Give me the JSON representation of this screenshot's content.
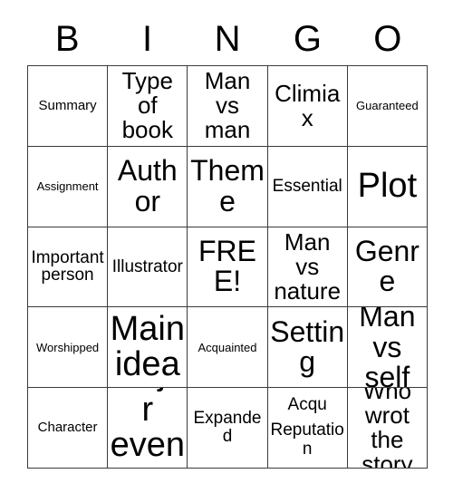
{
  "card": {
    "type": "bingo-card",
    "columns": 5,
    "rows": 5,
    "header_letters": [
      "B",
      "I",
      "N",
      "G",
      "O"
    ],
    "grid": [
      [
        {
          "text": "Summary",
          "size": "sm"
        },
        {
          "text": "Type of book",
          "size": "xl"
        },
        {
          "text": "Man vs man",
          "size": "xl"
        },
        {
          "text": "Climiax",
          "size": "xl"
        },
        {
          "text": "Guaranteed",
          "size": "xs"
        }
      ],
      [
        {
          "text": "Assignment",
          "size": "xs"
        },
        {
          "text": "Author",
          "size": "xxl"
        },
        {
          "text": "Theme",
          "size": "xxl"
        },
        {
          "text": "Essential",
          "size": "md"
        },
        {
          "text": "Plot",
          "size": "huge"
        }
      ],
      [
        {
          "text": "Important person",
          "size": "md"
        },
        {
          "text": "Illustrator",
          "size": "md"
        },
        {
          "text": "FREE!",
          "size": "xxl"
        },
        {
          "text": "Man vs nature",
          "size": "xl"
        },
        {
          "text": "Genre",
          "size": "xxl"
        }
      ],
      [
        {
          "text": "Worshipped",
          "size": "xs"
        },
        {
          "text": "Main idea",
          "size": "huge"
        },
        {
          "text": "Acquainted",
          "size": "xs"
        },
        {
          "text": "Setting",
          "size": "xxl"
        },
        {
          "text": "Man vs self",
          "size": "xxl"
        }
      ],
      [
        {
          "text": "Character",
          "size": "sm"
        },
        {
          "text": "Major event",
          "size": "huge"
        },
        {
          "text": "Expanded",
          "size": "md"
        },
        {
          "text": "Acqu",
          "size": "md",
          "text2": "Reputation",
          "size2": "md"
        },
        {
          "text": "Who wrot the story",
          "size": "xl"
        }
      ]
    ]
  }
}
